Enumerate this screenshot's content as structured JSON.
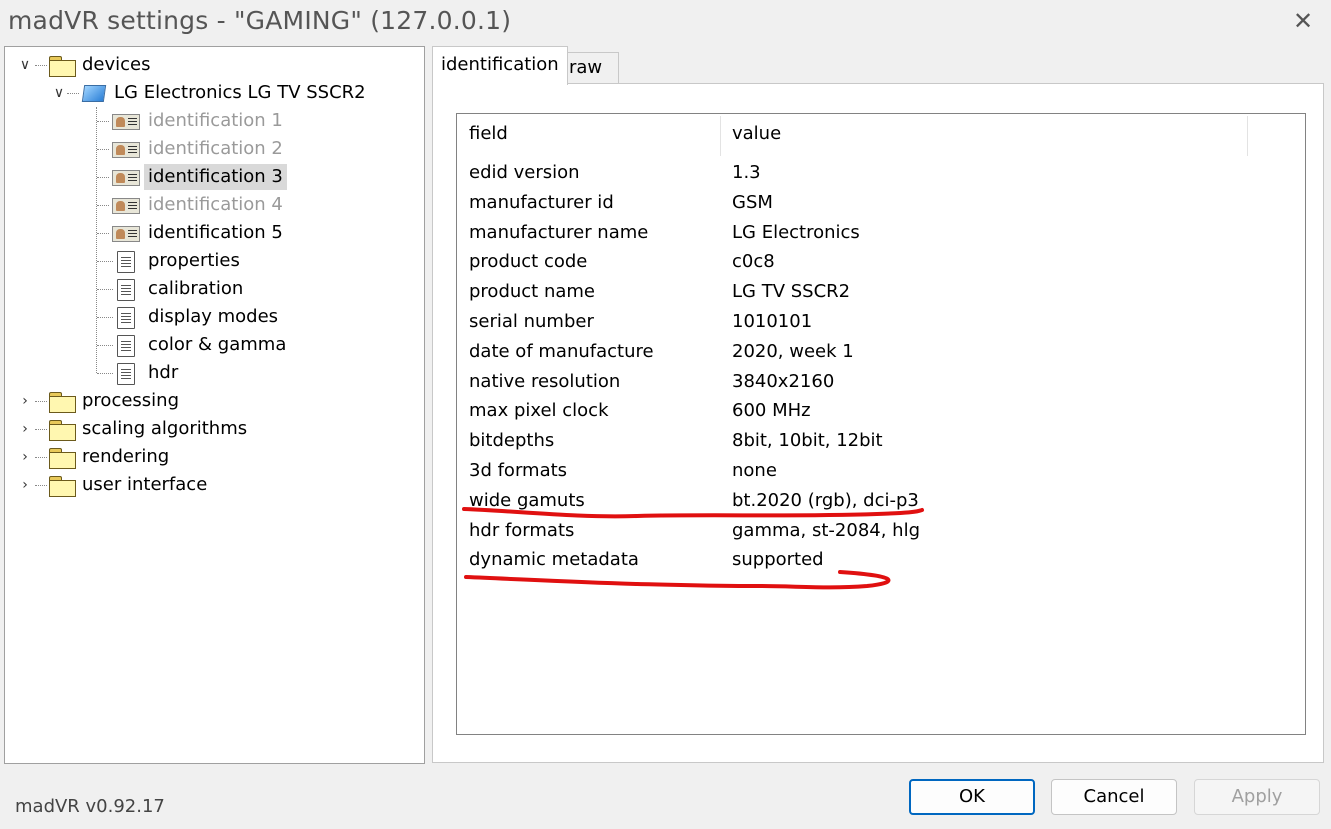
{
  "window": {
    "title": "madVR settings - \"GAMING\" (127.0.0.1)",
    "close_glyph": "✕"
  },
  "tree": {
    "devices": "devices",
    "device_name": "LG Electronics LG TV SSCR2",
    "identifications": [
      {
        "label": "identification 1",
        "state": "disabled"
      },
      {
        "label": "identification 2",
        "state": "disabled"
      },
      {
        "label": "identification 3",
        "state": "selected"
      },
      {
        "label": "identification 4",
        "state": "disabled"
      },
      {
        "label": "identification 5",
        "state": "normal"
      }
    ],
    "pages": [
      "properties",
      "calibration",
      "display modes",
      "color & gamma",
      "hdr"
    ],
    "categories": [
      "processing",
      "scaling algorithms",
      "rendering",
      "user interface"
    ]
  },
  "tabs": [
    {
      "label": "identification",
      "active": true
    },
    {
      "label": "raw edid data",
      "active": false
    }
  ],
  "table": {
    "headers": [
      "field",
      "value"
    ],
    "rows": [
      {
        "field": "edid version",
        "value": "1.3"
      },
      {
        "field": "manufacturer id",
        "value": "GSM"
      },
      {
        "field": "manufacturer name",
        "value": "LG Electronics"
      },
      {
        "field": "product code",
        "value": "c0c8"
      },
      {
        "field": "product name",
        "value": "LG TV SSCR2"
      },
      {
        "field": "serial number",
        "value": "1010101"
      },
      {
        "field": "date of manufacture",
        "value": "2020, week 1"
      },
      {
        "field": "native resolution",
        "value": "3840x2160"
      },
      {
        "field": "max pixel clock",
        "value": "600 MHz"
      },
      {
        "field": "bitdepths",
        "value": "8bit, 10bit, 12bit"
      },
      {
        "field": "3d formats",
        "value": "none"
      },
      {
        "field": "wide gamuts",
        "value": "bt.2020 (rgb), dci-p3"
      },
      {
        "field": "hdr formats",
        "value": "gamma, st-2084, hlg"
      },
      {
        "field": "dynamic metadata",
        "value": "supported"
      }
    ]
  },
  "annotation_color": "#e01010",
  "footer": {
    "version": "madVR v0.92.17",
    "ok": "OK",
    "cancel": "Cancel",
    "apply": "Apply"
  }
}
